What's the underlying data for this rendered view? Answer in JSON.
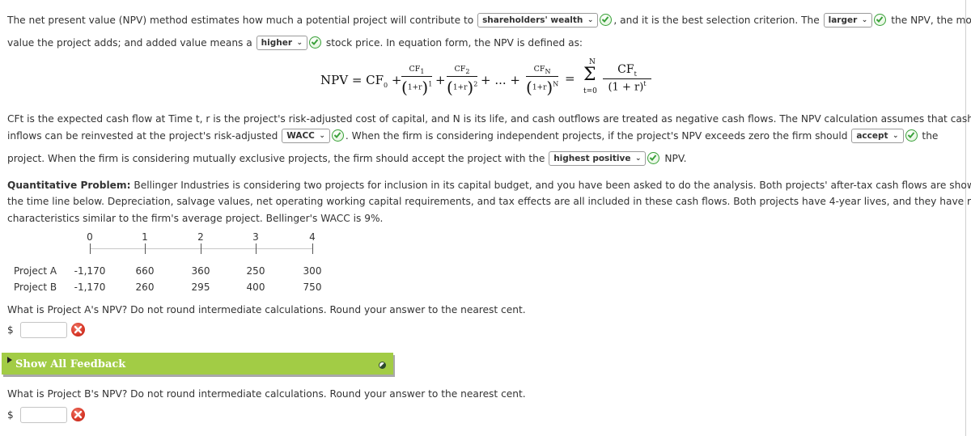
{
  "intro": {
    "line1_a": "The net present value (NPV) method estimates how much a potential project will contribute to",
    "select_wealth": "shareholders' wealth",
    "line1_b": ", and it is the best selection criterion. The",
    "select_larger": "larger",
    "line1_c": "the NPV, the more",
    "line2_a": "value the project adds; and added value means a",
    "select_higher": "higher",
    "line2_b": "stock price. In equation form, the NPV is defined as:"
  },
  "formula": {
    "lhs": "NPV = CF",
    "sub0": "0",
    "plus": "+",
    "cf1": "CF",
    "cf1_sub": "1",
    "cf2": "CF",
    "cf2_sub": "2",
    "cfn": "CF",
    "cfn_sub": "N",
    "one_plus_r": "1+r",
    "exp1": "1",
    "exp2": "2",
    "expN": "N",
    "ellipsis": "+ ... +",
    "equals": "=",
    "sigma": "Σ",
    "sigma_top": "N",
    "sigma_bottom": "t=0",
    "cft": "CF",
    "cft_sub": "t",
    "den_t": "(1 + r)",
    "den_t_exp": "t"
  },
  "explain": {
    "line1": "CFt is the expected cash flow at Time t, r is the project's risk-adjusted cost of capital, and N is its life, and cash outflows are treated as negative cash flows. The NPV calculation assumes that cash",
    "line2_a": "inflows can be reinvested at the project's risk-adjusted",
    "select_wacc": "WACC",
    "line2_b": ". When the firm is considering independent projects, if the project's NPV exceeds zero the firm should",
    "select_accept": "accept",
    "line2_c": "the",
    "line3_a": "project. When the firm is considering mutually exclusive projects, the firm should accept the project with the",
    "select_highest": "highest positive",
    "line3_b": "NPV."
  },
  "problem": {
    "bold": "Quantitative Problem:",
    "line1": " Bellinger Industries is considering two projects for inclusion in its capital budget, and you have been asked to do the analysis. Both projects' after-tax cash flows are shown on",
    "line2": "the time line below. Depreciation, salvage values, net operating working capital requirements, and tax effects are all included in these cash flows. Both projects have 4-year lives, and they have risk",
    "line3": "characteristics similar to the firm's average project. Bellinger's WACC is 9%."
  },
  "timeline": {
    "periods": [
      "0",
      "1",
      "2",
      "3",
      "4"
    ],
    "projects": [
      {
        "name": "Project A",
        "cash_flows": [
          "-1,170",
          "660",
          "360",
          "250",
          "300"
        ]
      },
      {
        "name": "Project B",
        "cash_flows": [
          "-1,170",
          "260",
          "295",
          "400",
          "750"
        ]
      }
    ]
  },
  "questions": [
    {
      "prompt": "What is Project A's NPV? Do not round intermediate calculations. Round your answer to the nearest cent.",
      "currency": "$",
      "value": "",
      "status": "incorrect"
    },
    {
      "prompt": "What is Project B's NPV? Do not round intermediate calculations. Round your answer to the nearest cent.",
      "currency": "$",
      "value": "",
      "status": "incorrect"
    }
  ],
  "feedback": {
    "label": "Show All Feedback"
  },
  "colors": {
    "feedback_green": "#a2cc45",
    "check_green": "#3aa13a",
    "error_red": "#d93a2a"
  }
}
